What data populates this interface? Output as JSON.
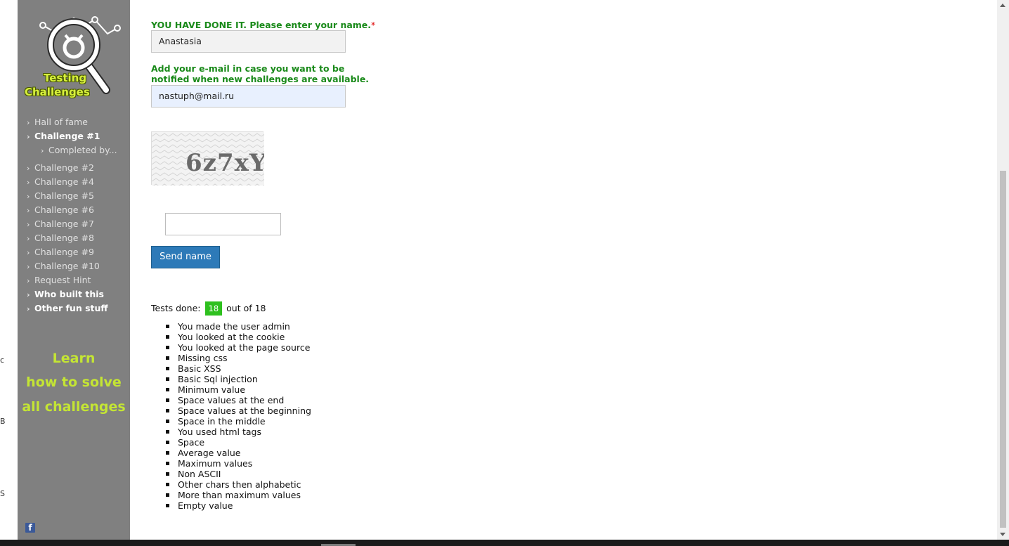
{
  "left_strip": {
    "fragments": [
      "c",
      "B",
      "S"
    ]
  },
  "sidebar": {
    "logo": {
      "line1": "Testing",
      "line2": "Challenges"
    },
    "nav": [
      {
        "label": "Hall of fame",
        "bold": false
      },
      {
        "label": "Challenge #1",
        "bold": true
      },
      {
        "label": "Completed by...",
        "sub": true
      },
      {
        "label": "Challenge #2"
      },
      {
        "label": "Challenge #4"
      },
      {
        "label": "Challenge #5"
      },
      {
        "label": "Challenge #6"
      },
      {
        "label": "Challenge #7"
      },
      {
        "label": "Challenge #8"
      },
      {
        "label": "Challenge #9"
      },
      {
        "label": "Challenge #10"
      },
      {
        "label": "Request Hint"
      },
      {
        "label": "Who built this",
        "bold": true
      },
      {
        "label": "Other fun stuff",
        "bold": true
      }
    ],
    "learn": {
      "line1": "Learn",
      "line2": "how to solve",
      "line3": "all challenges"
    },
    "facebook_icon": "facebook-icon",
    "facebook_letter": "f"
  },
  "form": {
    "name_label": "YOU HAVE DONE IT. Please enter your name.",
    "required_mark": "*",
    "name_value": "Anastasia",
    "email_label_line1": "Add your e-mail in case you want to be",
    "email_label_line2": "notified when new challenges are available.",
    "email_value": "nastuph@mail.ru",
    "captcha_text": "6z7xY",
    "captcha_input_value": "",
    "send_button": "Send name"
  },
  "tests": {
    "prefix": "Tests done:",
    "done": "18",
    "suffix": "out of 18",
    "items": [
      "You made the user admin",
      "You looked at the cookie",
      "You looked at the page source",
      "Missing css",
      "Basic XSS",
      "Basic Sql injection",
      "Minimum value",
      "Space values at the end",
      "Space values at the beginning",
      "Space in the middle",
      "You used html tags",
      "Space",
      "Average value",
      "Maximum values",
      "Non ASCII",
      "Other chars then alphabetic",
      "More than maximum values",
      "Empty value"
    ]
  },
  "colors": {
    "sidebar_bg": "#808080",
    "green_label": "#1a8a1a",
    "learn_text": "#c4e534",
    "button_bg": "#2d7ab8",
    "badge_bg": "#2ec01e"
  }
}
